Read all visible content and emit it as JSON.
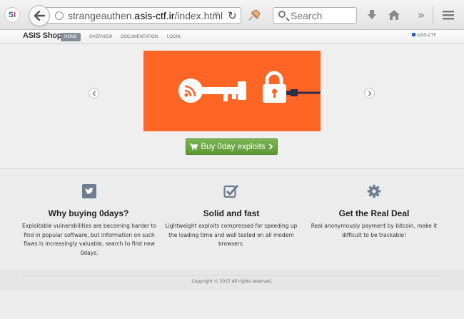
{
  "browser": {
    "favicon_text": "S",
    "url_prefix": "strangeauthen.",
    "url_host": "asis-ctf.ir",
    "url_path": "/index.html",
    "search_placeholder": "Search",
    "icons": [
      "back-icon",
      "globe-icon",
      "dropdown-icon",
      "reload-icon",
      "pin-icon",
      "search-icon",
      "download-icon",
      "home-icon",
      "overflow-icon",
      "menu-icon"
    ]
  },
  "navbar": {
    "brand": "ASIS Shop",
    "items": [
      "HOME",
      "OVERVIEW",
      "DOCUMENTATION",
      "LOGIN"
    ],
    "active_index": 0,
    "right_link": "ASIS-CTF"
  },
  "hero": {
    "slide_color": "#ff6525",
    "slide_icons": [
      "rss-icon",
      "key-icon",
      "padlock-icon",
      "cable-icon"
    ],
    "buy_button": "Buy 0day exploits",
    "button_color": "#6aa842"
  },
  "features": [
    {
      "icon": "twitter-icon",
      "title": "Why buying 0days?",
      "lines": [
        "Exploitable vulnerabilities are becoming harder to",
        "find in popular software, but information on such",
        "flaws is increasingly valuable, search to find new",
        "0days."
      ]
    },
    {
      "icon": "checkbox-icon",
      "title": "Solid and fast",
      "lines": [
        "Lightweight exploits compressed for speeding up",
        "the loading time and well tested on all modern",
        "browsers."
      ]
    },
    {
      "icon": "gear-icon",
      "title": "Get the Real Deal",
      "lines": [
        "Real anonymously payment by bitcoin, make it",
        "difficult to be trackable!"
      ]
    }
  ],
  "footer": {
    "copyright": "Copyright © 2015 All rights reserved."
  }
}
